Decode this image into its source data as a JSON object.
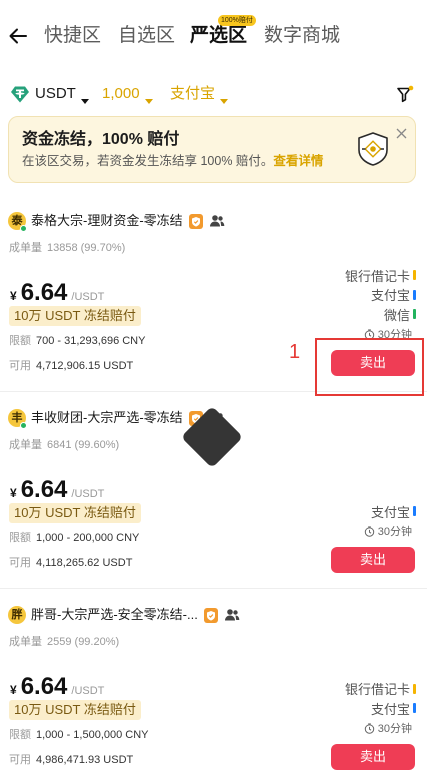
{
  "nav": {
    "back_icon": "arrow-left-icon",
    "tabs": [
      {
        "label": "快捷区",
        "selected": false
      },
      {
        "label": "自选区",
        "selected": false
      },
      {
        "label": "严选区",
        "selected": true,
        "badge": "100%赔付"
      },
      {
        "label": "数字商城",
        "selected": false
      }
    ]
  },
  "filters": {
    "coin": {
      "label": "USDT",
      "icon": "tether-icon"
    },
    "amount": "1,000",
    "payment_method": "支付宝",
    "filter_icon": "funnel-filter-icon"
  },
  "banner": {
    "title": "资金冻结，100% 赔付",
    "text": "在该区交易，若资金发生冻结享 100% 赔付。",
    "link": "查看详情",
    "icon": "shield-icon",
    "close_icon": "close-icon"
  },
  "labels": {
    "orders": "成单量",
    "currency_symbol": "¥",
    "price_unit": "/USDT",
    "limit": "限额",
    "available": "可用",
    "sell": "卖出",
    "time_icon": "clock-icon"
  },
  "merchants": [
    {
      "avatar": "泰",
      "name": "泰格大宗-理财资金-零冻结",
      "badges": [
        "verified-merchant-icon",
        "group-icon"
      ],
      "orders": "13858 (99.70%)",
      "price": "6.64",
      "guarantee_tag": "10万 USDT 冻结赔付",
      "limit": "700 - 31,293,696 CNY",
      "available": "4,712,906.15 USDT",
      "payments": [
        {
          "name": "银行借记卡",
          "color": "#f5b400"
        },
        {
          "name": "支付宝",
          "color": "#1a7cff"
        },
        {
          "name": "微信",
          "color": "#22b35e"
        }
      ],
      "time": "30分钟"
    },
    {
      "avatar": "丰",
      "name": "丰收财团-大宗严选-零冻结",
      "badges": [
        "verified-merchant-icon",
        "group-icon"
      ],
      "orders": "6841 (99.60%)",
      "price": "6.64",
      "guarantee_tag": "10万 USDT 冻结赔付",
      "limit": "1,000 - 200,000 CNY",
      "available": "4,118,265.62 USDT",
      "payments": [
        {
          "name": "支付宝",
          "color": "#1a7cff"
        }
      ],
      "time": "30分钟"
    },
    {
      "avatar": "胖",
      "name": "胖哥-大宗严选-安全零冻结-...",
      "badges": [
        "verified-merchant-icon",
        "group-icon"
      ],
      "orders": "2559 (99.20%)",
      "price": "6.64",
      "guarantee_tag": "10万 USDT 冻结赔付",
      "limit": "1,000 - 1,500,000 CNY",
      "available": "4,986,471.93 USDT",
      "payments": [
        {
          "name": "银行借记卡",
          "color": "#f5b400"
        },
        {
          "name": "支付宝",
          "color": "#1a7cff"
        }
      ],
      "time": "30分钟"
    }
  ],
  "annotation": {
    "label": "1",
    "color": "#e53935"
  },
  "colors": {
    "accent_gold": "#d9a400",
    "sell_red": "#ef3d55",
    "tag_bg": "#fbeecb",
    "banner_bg": "#fdf6df"
  }
}
